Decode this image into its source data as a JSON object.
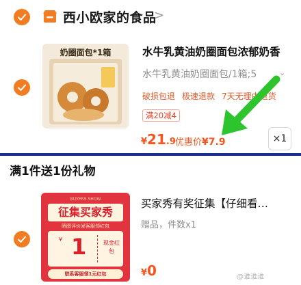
{
  "store": {
    "name": "西小欧家的食品",
    "chevron": ">",
    "icon": "store-icon",
    "selected": true
  },
  "product": {
    "selected": true,
    "thumb_label": "奶圈面包*1箱",
    "title": "水牛乳黄油奶圈面包浓郁奶香",
    "variant": "水牛乳黄油奶圈面包/1箱;5",
    "tags": [
      "破损包退",
      "极速退款",
      "7天无理由退货"
    ],
    "promo": "满20减4",
    "price_symbol": "¥",
    "price_int": "21",
    "price_dec": ".9",
    "deal_label": "优惠价",
    "deal_value": "¥7.9",
    "quantity": "×1"
  },
  "gift": {
    "header": "满1件送1份礼物",
    "selected": true,
    "title": "买家秀有奖征集【仔细看…",
    "subtitle": "赠品，件数x1",
    "price_symbol": "¥",
    "price_int": "0",
    "thumb": {
      "banner": "BUYERS SHOW",
      "big": "征集买家秀",
      "sub": "晒图评价发客服领红包",
      "coupon_symbol": "¥",
      "coupon_value": "1",
      "coupon_text": "现金红包",
      "footer": "联系客服领1元红包"
    }
  },
  "watermark": "@谁谁谁",
  "colors": {
    "accent": "#f27c22",
    "price": "#f5561f",
    "arrow": "#2ec42e",
    "divider": "#1d2c8f"
  }
}
